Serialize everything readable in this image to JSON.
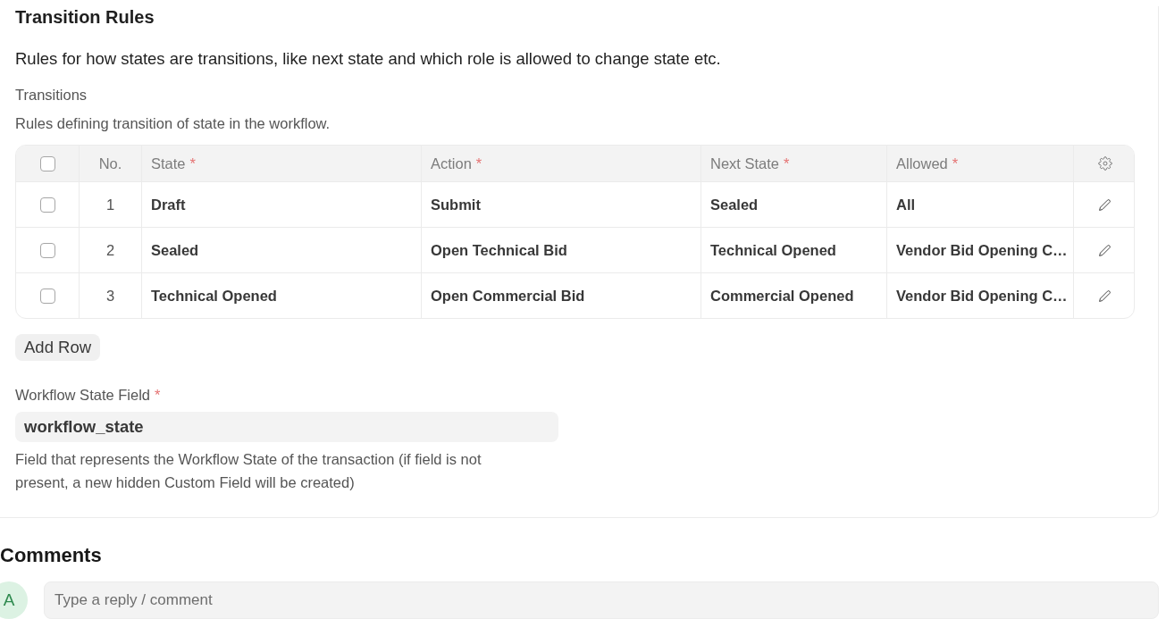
{
  "section": {
    "title": "Transition Rules",
    "description": "Rules for how states are transitions, like next state and which role is allowed to change state etc.",
    "transitions": {
      "label": "Transitions",
      "help": "Rules defining transition of state in the workflow.",
      "table": {
        "select_all": {
          "checked": false
        },
        "columns": [
          {
            "kind": "number",
            "label": "No."
          },
          {
            "kind": "text",
            "label": "State",
            "required_mark": "*"
          },
          {
            "kind": "text",
            "label": "Action",
            "required_mark": "*"
          },
          {
            "kind": "text",
            "label": "Next State",
            "required_mark": "*"
          },
          {
            "kind": "text",
            "label": "Allowed",
            "required_mark": "*"
          }
        ],
        "rows": [
          {
            "selected": false,
            "cells": [
              "1",
              "Draft",
              "Submit",
              "Sealed",
              "All"
            ]
          },
          {
            "selected": false,
            "cells": [
              "2",
              "Sealed",
              "Open Technical Bid",
              "Technical Opened",
              "Vendor Bid Opening C…"
            ]
          },
          {
            "selected": false,
            "cells": [
              "3",
              "Technical Opened",
              "Open Commercial Bid",
              "Commercial Opened",
              "Vendor Bid Opening C…"
            ]
          }
        ]
      },
      "add_button": "Add Row"
    },
    "state_field": {
      "label": "Workflow State Field",
      "required_mark": "*",
      "value": "workflow_state",
      "help": "Field that represents the Workflow State of the transaction (if field is not present, a new hidden Custom Field will be created)"
    }
  },
  "comments": {
    "title": "Comments",
    "avatar": {
      "initial": "A"
    },
    "input": {
      "placeholder": "Type a reply / comment"
    }
  }
}
